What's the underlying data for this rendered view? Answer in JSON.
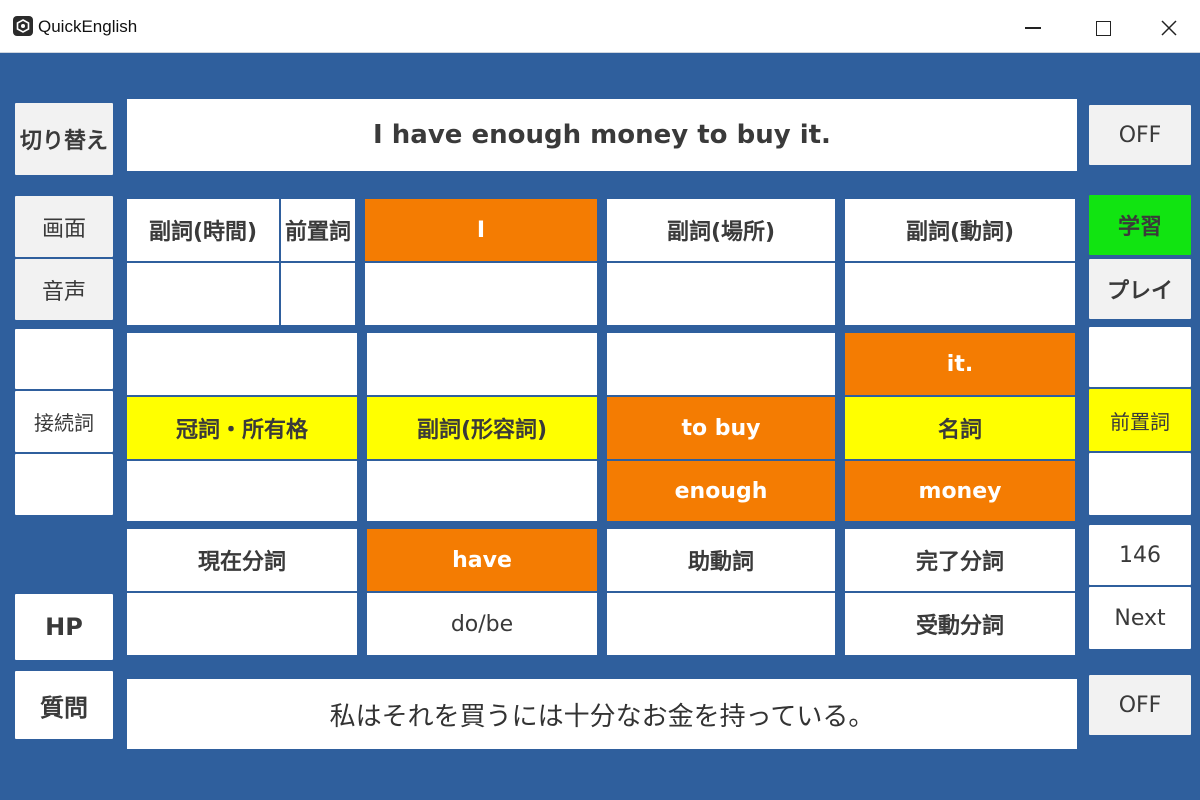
{
  "window": {
    "title": "QuickEnglish"
  },
  "left": {
    "switch": "切り替え",
    "screen": "画面",
    "voice": "音声",
    "conjunction": "接続詞",
    "hp": "HP",
    "question": "質問"
  },
  "sentence": "I have enough money to buy it.",
  "translation": "私はそれを買うには十分なお金を持っている。",
  "right": {
    "off_top": "OFF",
    "study": "学習",
    "play": "プレイ",
    "preposition": "前置詞",
    "count": "146",
    "next": "Next",
    "off_bottom": "OFF"
  },
  "grid": {
    "adv_time": "副詞(時間)",
    "preposition": "前置詞",
    "subject": "I",
    "adv_place": "副詞(場所)",
    "adv_verb": "副詞(動詞)",
    "obj": "it.",
    "article": "冠詞・所有格",
    "adv_adj": "副詞(形容詞)",
    "infinitive": "to buy",
    "noun": "名詞",
    "enough": "enough",
    "money": "money",
    "present_participle": "現在分詞",
    "verb": "have",
    "auxiliary": "助動詞",
    "perfect_participle": "完了分詞",
    "dobe": "do/be",
    "passive_participle": "受動分詞"
  },
  "colors": {
    "background": "#2f5f9d",
    "orange": "#f47c02",
    "yellow": "#ffff00",
    "green": "#11e411"
  }
}
